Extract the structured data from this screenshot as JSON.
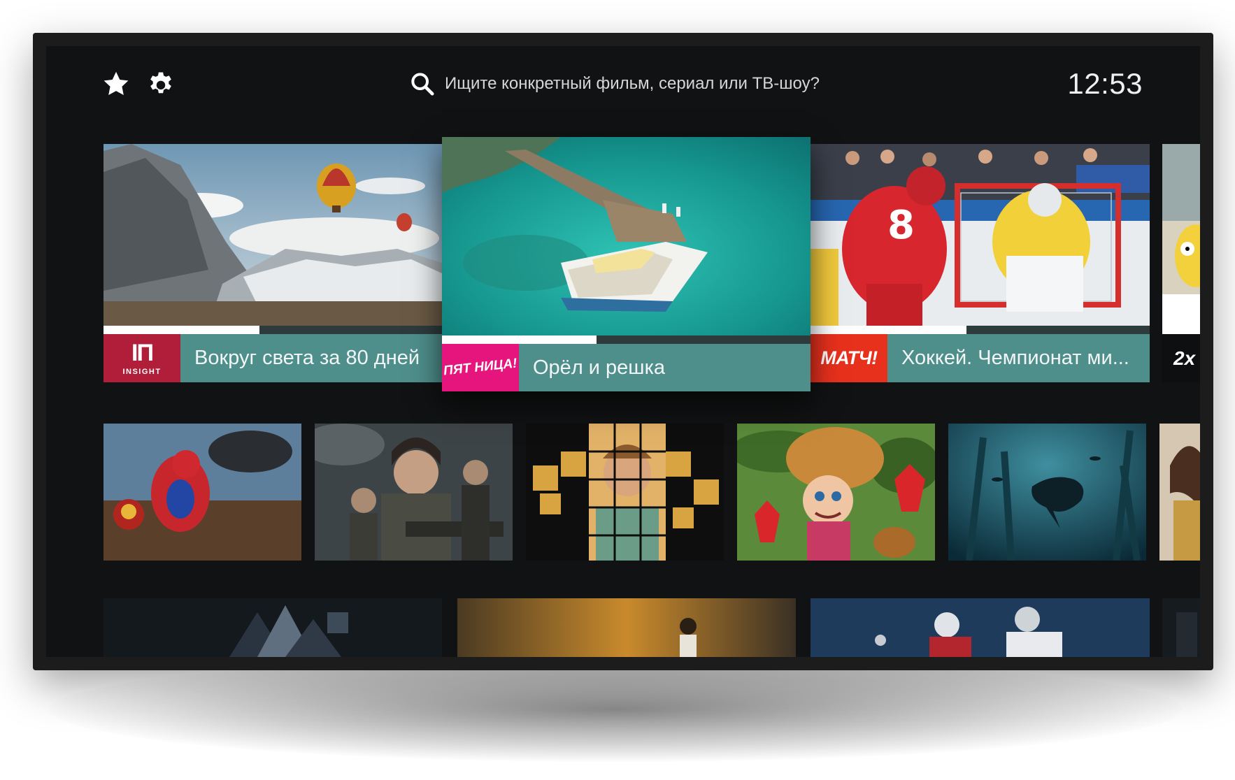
{
  "topbar": {
    "favorites_icon": "star-icon",
    "settings_icon": "gear-icon",
    "search_icon": "search-icon",
    "search_placeholder": "Ищите конкретный фильм, сериал или ТВ-шоу?",
    "clock": "12:53"
  },
  "channels": [
    {
      "logo_mark": "IΠ",
      "logo_text": "INSIGHT",
      "title": "Вокруг света за 80 дней",
      "progress": 0.46,
      "logo_color": "#b01e3a",
      "preview": "hot-air-balloons-over-mountains"
    },
    {
      "logo_text": "ПЯТ НИЦА!",
      "title": "Орёл и решка",
      "progress": 0.42,
      "logo_color": "#e6157e",
      "preview": "boat-at-turquoise-pier",
      "focused": true
    },
    {
      "logo_text": "МАТЧ!",
      "title": "Хоккей. Чемпионат ми...",
      "progress": 0.46,
      "logo_color": "#e8311d",
      "preview": "hockey-player-and-goalie"
    },
    {
      "logo_text": "2x",
      "title": "",
      "progress": 1.0,
      "logo_color": "#0e0f10",
      "preview": "cartoon-character"
    }
  ],
  "posters_row1": [
    {
      "name": "spider-man-poster"
    },
    {
      "name": "alien-covenant-poster"
    },
    {
      "name": "the-good-doctor-poster"
    },
    {
      "name": "masha-and-the-bear-poster"
    },
    {
      "name": "underwater-documentary-poster"
    },
    {
      "name": "woman-in-gold-dress-poster"
    }
  ],
  "posters_row2": [
    {
      "name": "abstract-dark-poster"
    },
    {
      "name": "football-sunset-poster"
    },
    {
      "name": "hockey-players-poster"
    },
    {
      "name": "partial-dark-poster"
    }
  ],
  "colors": {
    "screen_bg": "#111213",
    "info_bar": "#4e8e8b",
    "progress_fill": "#ffffff"
  }
}
